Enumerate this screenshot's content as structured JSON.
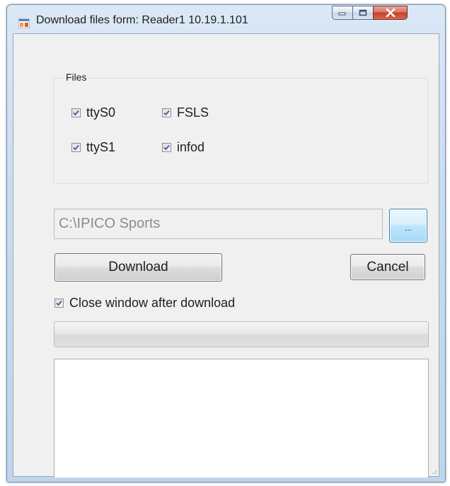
{
  "window": {
    "title": "Download files form: Reader1 10.19.1.101"
  },
  "files_group": {
    "label": "Files",
    "items": [
      {
        "label": "ttyS0",
        "checked": true
      },
      {
        "label": "FSLS",
        "checked": true
      },
      {
        "label": "ttyS1",
        "checked": true
      },
      {
        "label": "infod",
        "checked": true
      }
    ]
  },
  "path": {
    "value": "C:\\IPICO Sports",
    "browse_label": "..."
  },
  "actions": {
    "download_label": "Download",
    "cancel_label": "Cancel"
  },
  "options": {
    "close_after_download_label": "Close window after download",
    "close_after_download_checked": true
  },
  "progress": {
    "value": 0
  },
  "log": {
    "text": ""
  },
  "colors": {
    "accent": "#3c7fb1",
    "close_button": "#c2402a",
    "checkmark": "#3a5e9c"
  },
  "icons": {
    "app": "app-form-icon",
    "minimize": "minimize-icon",
    "maximize": "maximize-icon",
    "close": "close-icon",
    "check": "checkmark-icon",
    "grip": "resize-grip-icon"
  }
}
